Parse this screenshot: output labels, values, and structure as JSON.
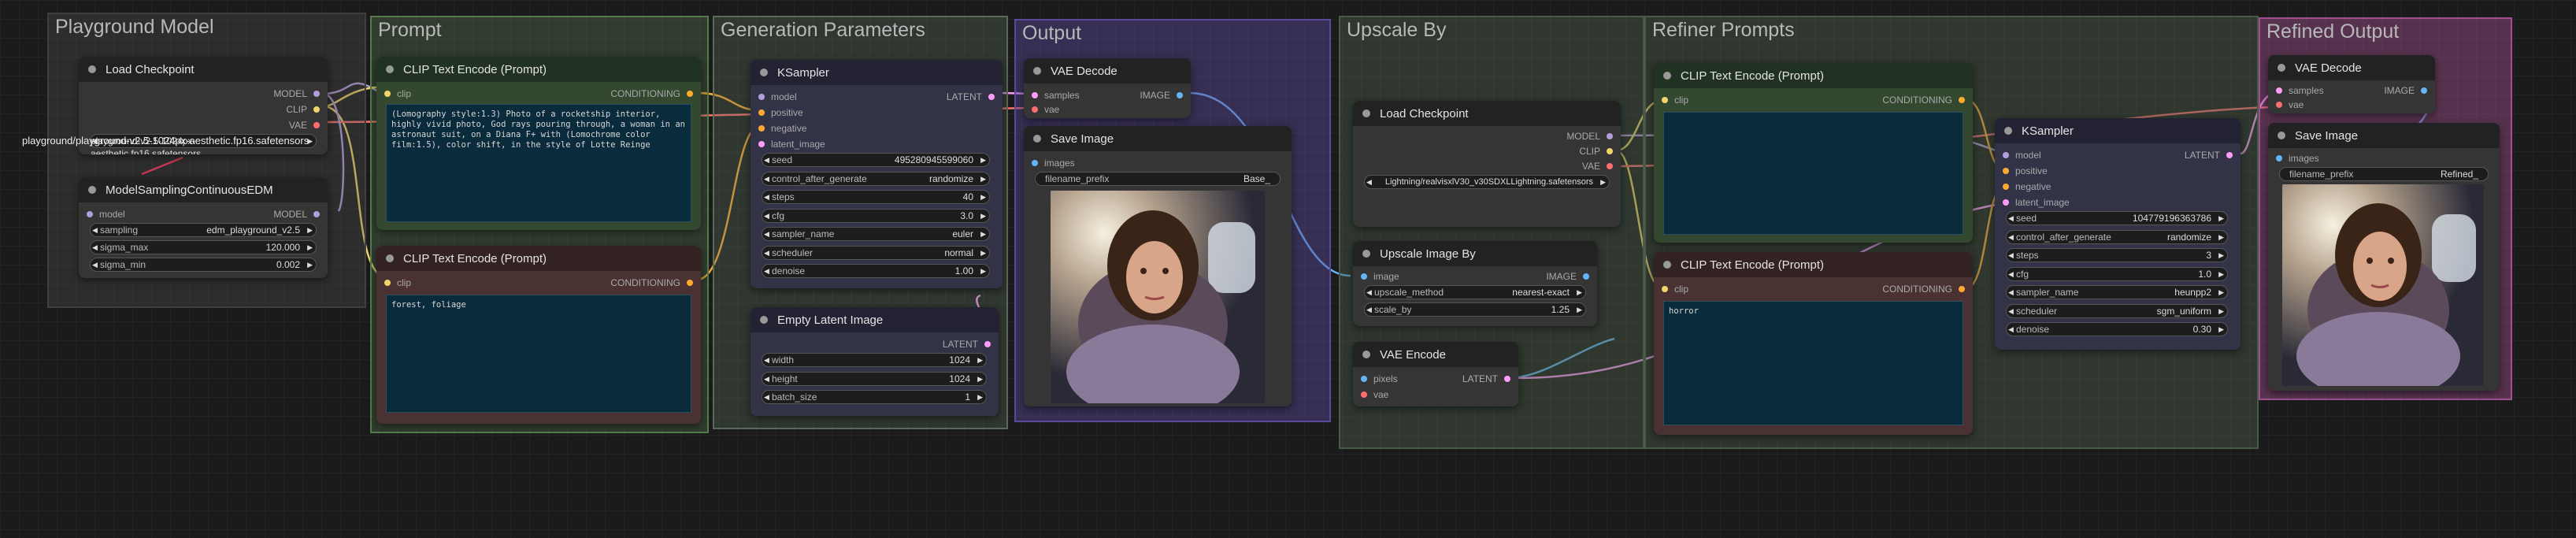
{
  "groups": {
    "playground": "Playground Model",
    "prompt": "Prompt",
    "gen": "Generation Parameters",
    "output": "Output",
    "upscale": "Upscale By",
    "refiner": "Refiner  Prompts",
    "refined": "Refined Output"
  },
  "load_ckpt_1": {
    "title": "Load Checkpoint",
    "out_model": "MODEL",
    "out_clip": "CLIP",
    "out_vae": "VAE",
    "ckpt_name": "playground-v2.5-1024px-aesthetic.fp16.safetensors",
    "overlay_label": "playground/playground-v2.5-1024px-aesthetic.fp16.safetensors"
  },
  "msc": {
    "title": "ModelSamplingContinuousEDM",
    "in_model": "model",
    "out_model": "MODEL",
    "sampling_label": "sampling",
    "sampling": "edm_playground_v2.5",
    "sigma_max_label": "sigma_max",
    "sigma_max": "120.000",
    "sigma_min_label": "sigma_min",
    "sigma_min": "0.002"
  },
  "clip_pos": {
    "title": "CLIP Text Encode (Prompt)",
    "in_clip": "clip",
    "out": "CONDITIONING",
    "text": "(Lomography style:1.3) Photo of a rocketship interior, highly vivid photo, God rays pouring through, a woman in an astronaut suit, on a Diana F+ with (Lomochrome color film:1.5), color shift, in the style of Lotte Reinge"
  },
  "clip_neg": {
    "title": "CLIP Text Encode (Prompt)",
    "in_clip": "clip",
    "out": "CONDITIONING",
    "text": "forest, foliage"
  },
  "ksampler_1": {
    "title": "KSampler",
    "in_model": "model",
    "in_pos": "positive",
    "in_neg": "negative",
    "in_latent": "latent_image",
    "out": "LATENT",
    "widgets": [
      {
        "label": "seed",
        "value": "495280945599060"
      },
      {
        "label": "control_after_generate",
        "value": "randomize"
      },
      {
        "label": "steps",
        "value": "40"
      },
      {
        "label": "cfg",
        "value": "3.0"
      },
      {
        "label": "sampler_name",
        "value": "euler"
      },
      {
        "label": "scheduler",
        "value": "normal"
      },
      {
        "label": "denoise",
        "value": "1.00"
      }
    ]
  },
  "empty_latent": {
    "title": "Empty Latent Image",
    "out": "LATENT",
    "widgets": [
      {
        "label": "width",
        "value": "1024"
      },
      {
        "label": "height",
        "value": "1024"
      },
      {
        "label": "batch_size",
        "value": "1"
      }
    ]
  },
  "vae_decode_1": {
    "title": "VAE Decode",
    "in_samples": "samples",
    "in_vae": "vae",
    "out": "IMAGE"
  },
  "save_image_1": {
    "title": "Save Image",
    "in_images": "images",
    "prefix_label": "filename_prefix",
    "prefix": "Base_"
  },
  "load_ckpt_2": {
    "title": "Load Checkpoint",
    "out_model": "MODEL",
    "out_clip": "CLIP",
    "out_vae": "VAE",
    "ckpt_name": "Lightning/realvisxlV30_v30SDXLLightning.safetensors"
  },
  "upscale": {
    "title": "Upscale Image By",
    "in_image": "image",
    "out": "IMAGE",
    "method_label": "upscale_method",
    "method": "nearest-exact",
    "scale_label": "scale_by",
    "scale": "1.25"
  },
  "vae_encode": {
    "title": "VAE Encode",
    "in_pixels": "pixels",
    "in_vae": "vae",
    "out": "LATENT"
  },
  "clip_ref_pos": {
    "title": "CLIP Text Encode (Prompt)",
    "in_clip": "clip",
    "out": "CONDITIONING",
    "text": ""
  },
  "clip_ref_neg": {
    "title": "CLIP Text Encode (Prompt)",
    "in_clip": "clip",
    "out": "CONDITIONING",
    "text": "horror"
  },
  "ksampler_2": {
    "title": "KSampler",
    "in_model": "model",
    "in_pos": "positive",
    "in_neg": "negative",
    "in_latent": "latent_image",
    "out": "LATENT",
    "widgets": [
      {
        "label": "seed",
        "value": "104779196363786"
      },
      {
        "label": "control_after_generate",
        "value": "randomize"
      },
      {
        "label": "steps",
        "value": "3"
      },
      {
        "label": "cfg",
        "value": "1.0"
      },
      {
        "label": "sampler_name",
        "value": "heunpp2"
      },
      {
        "label": "scheduler",
        "value": "sgm_uniform"
      },
      {
        "label": "denoise",
        "value": "0.30"
      }
    ]
  },
  "vae_decode_2": {
    "title": "VAE Decode",
    "in_samples": "samples",
    "in_vae": "vae",
    "out": "IMAGE"
  },
  "save_image_2": {
    "title": "Save Image",
    "in_images": "images",
    "prefix_label": "filename_prefix",
    "prefix": "Refined_"
  },
  "colors": {
    "model": "#b39ddb",
    "clip": "#f0d56a",
    "vae": "#ff6e6e",
    "conditioning": "#ffa931",
    "latent": "#ff9cf9",
    "image": "#64b5f6",
    "group_playground": "#3f3f3f",
    "group_prompt": "#567a4e",
    "group_gen": "#5a6a58",
    "group_output": "#5b4a9a",
    "group_upscale": "#4a5a4a",
    "group_refined": "#a0508f"
  }
}
